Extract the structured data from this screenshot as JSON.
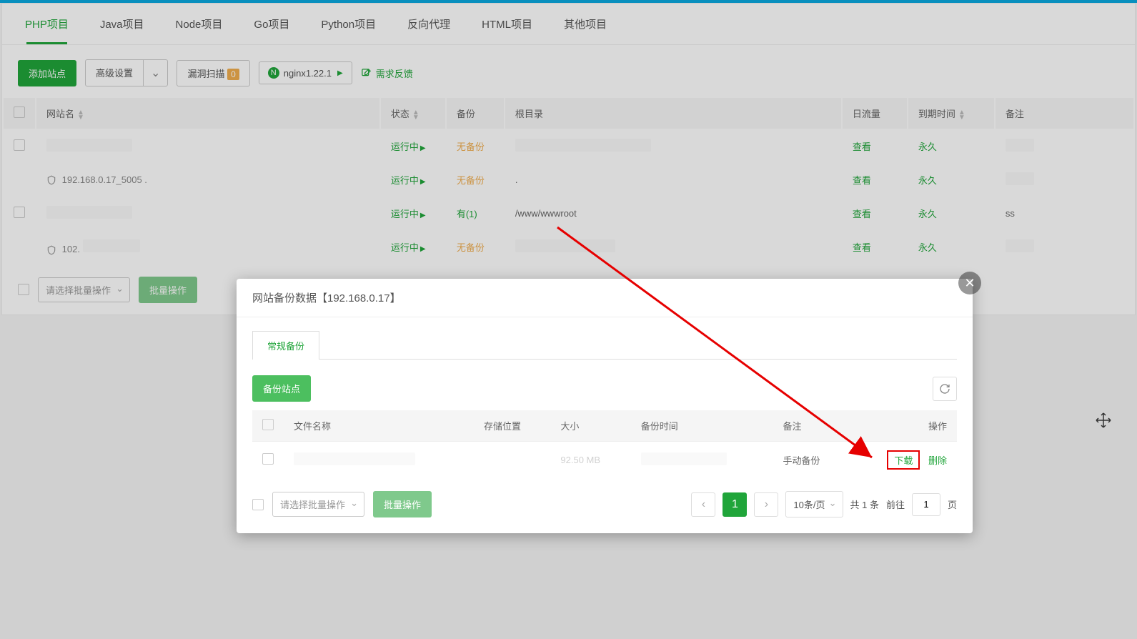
{
  "tabs": [
    "PHP项目",
    "Java项目",
    "Node项目",
    "Go项目",
    "Python项目",
    "反向代理",
    "HTML项目",
    "其他项目"
  ],
  "toolbar": {
    "add_site": "添加站点",
    "advanced": "高级设置",
    "scan": "漏洞扫描",
    "scan_badge": "0",
    "nginx": "nginx1.22.1",
    "feedback": "需求反馈"
  },
  "columns": {
    "name": "网站名",
    "status": "状态",
    "backup": "备份",
    "root": "根目录",
    "traffic": "日流量",
    "expire": "到期时间",
    "remark": "备注"
  },
  "rows": [
    {
      "name": "",
      "status": "运行中",
      "backup": "无备份",
      "root": "",
      "traffic": "查看",
      "expire": "永久",
      "remark": ""
    },
    {
      "name": "192.168.0.17_5005 .",
      "status": "运行中",
      "backup": "无备份",
      "root": ".",
      "traffic": "查看",
      "expire": "永久",
      "remark": ""
    },
    {
      "name": "",
      "status": "运行中",
      "backup": "有(1)",
      "root": "/www/wwwroot",
      "traffic": "查看",
      "expire": "永久",
      "remark": "ss"
    },
    {
      "name": "102.",
      "status": "运行中",
      "backup": "无备份",
      "root": "",
      "traffic": "查看",
      "expire": "永久",
      "remark": ""
    }
  ],
  "batch": {
    "placeholder": "请选择批量操作",
    "button": "批量操作"
  },
  "modal": {
    "title": "网站备份数据【192.168.0.17】",
    "tab": "常规备份",
    "backup_btn": "备份站点",
    "columns": {
      "file": "文件名称",
      "storage": "存储位置",
      "size": "大小",
      "time": "备份时间",
      "remark": "备注",
      "action": "操作"
    },
    "row": {
      "size": "92.50 MB",
      "remark": "手动备份",
      "download": "下载",
      "delete": "删除"
    },
    "batch": {
      "placeholder": "请选择批量操作",
      "button": "批量操作"
    },
    "page_size": "10条/页",
    "total": "共 1 条",
    "goto": "前往",
    "page": "1",
    "page_suffix": "页"
  }
}
